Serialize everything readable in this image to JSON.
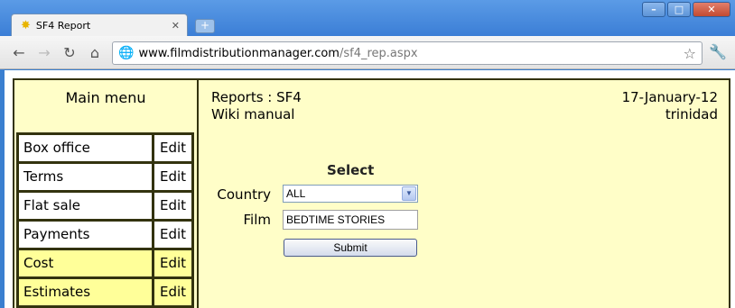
{
  "browser": {
    "tab_title": "SF4 Report",
    "tab_icon": "star-icon",
    "new_tab_label": "+",
    "url_host": "www.filmdistributionmanager.com",
    "url_path": "/sf4_rep.aspx"
  },
  "menu": {
    "title": "Main menu",
    "items": [
      {
        "label": "Box office",
        "edit": "Edit",
        "highlighted": false
      },
      {
        "label": "Terms",
        "edit": "Edit",
        "highlighted": false
      },
      {
        "label": "Flat sale",
        "edit": "Edit",
        "highlighted": false
      },
      {
        "label": "Payments",
        "edit": "Edit",
        "highlighted": false
      },
      {
        "label": "Cost",
        "edit": "Edit",
        "highlighted": true
      },
      {
        "label": "Estimates",
        "edit": "Edit",
        "highlighted": true
      }
    ]
  },
  "header": {
    "report_title": "Reports : SF4",
    "manual_link": "Wiki manual",
    "date": "17-January-12",
    "user": "trinidad"
  },
  "form": {
    "section_title": "Select",
    "country_label": "Country",
    "country_value": "ALL",
    "film_label": "Film",
    "film_value": "BEDTIME STORIES",
    "submit_label": "Submit"
  },
  "colors": {
    "page_background": "#fffec8",
    "menu_border": "#33330f",
    "menu_highlight": "#ffff99"
  }
}
